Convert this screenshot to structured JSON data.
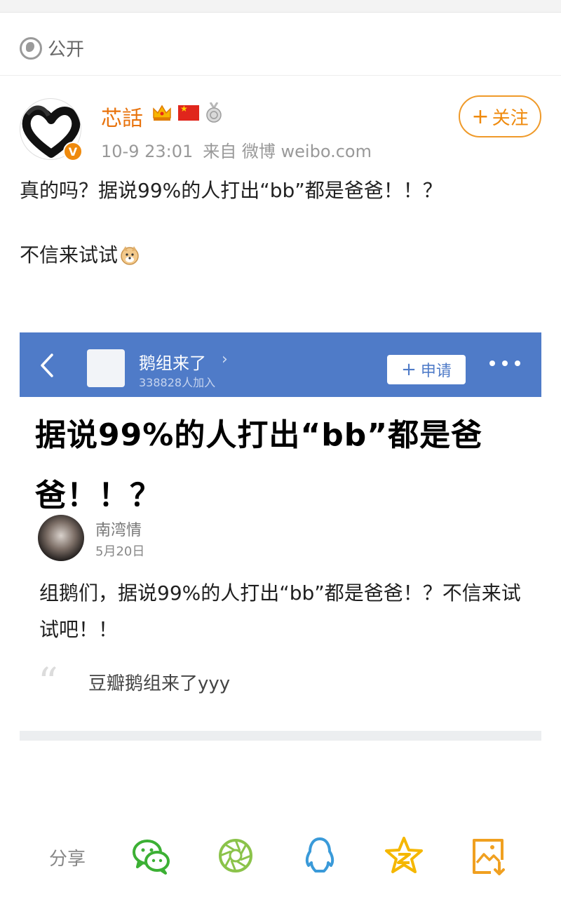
{
  "privacy": {
    "label": "公开"
  },
  "author": {
    "name": "芯話",
    "verified_mark": "V",
    "time": "10-9 23:01",
    "source": "来自 微博 weibo.com",
    "follow_label": "关注",
    "follow_plus": "+"
  },
  "post": {
    "line1": "真的吗？据说99%的人打出“bb”都是爸爸！！？",
    "line2": "不信来试试"
  },
  "embed": {
    "header": {
      "group_name": "鹅组来了",
      "chevron": "›",
      "member_count": "338828人加入",
      "apply_plus": "+",
      "apply_label": "申请"
    },
    "title": "据说99%的人打出“bb”都是爸爸！！？",
    "author": "南湾情",
    "date": "5月20日",
    "body": "组鹅们，据说99%的人打出“bb”都是爸爸！？不信来试试吧！！",
    "quote_mark": "“",
    "source": "豆瓣鹅组来了yyy"
  },
  "share": {
    "label": "分享",
    "icons": [
      "wechat-icon",
      "moments-icon",
      "qq-icon",
      "qzone-icon",
      "save-image-icon"
    ]
  },
  "colors": {
    "accent_orange": "#ef8a0d",
    "header_blue": "#4f7bc8",
    "wechat_green": "#3cb034",
    "qq_blue": "#3a9ad9",
    "qzone_yellow": "#f5b700"
  }
}
